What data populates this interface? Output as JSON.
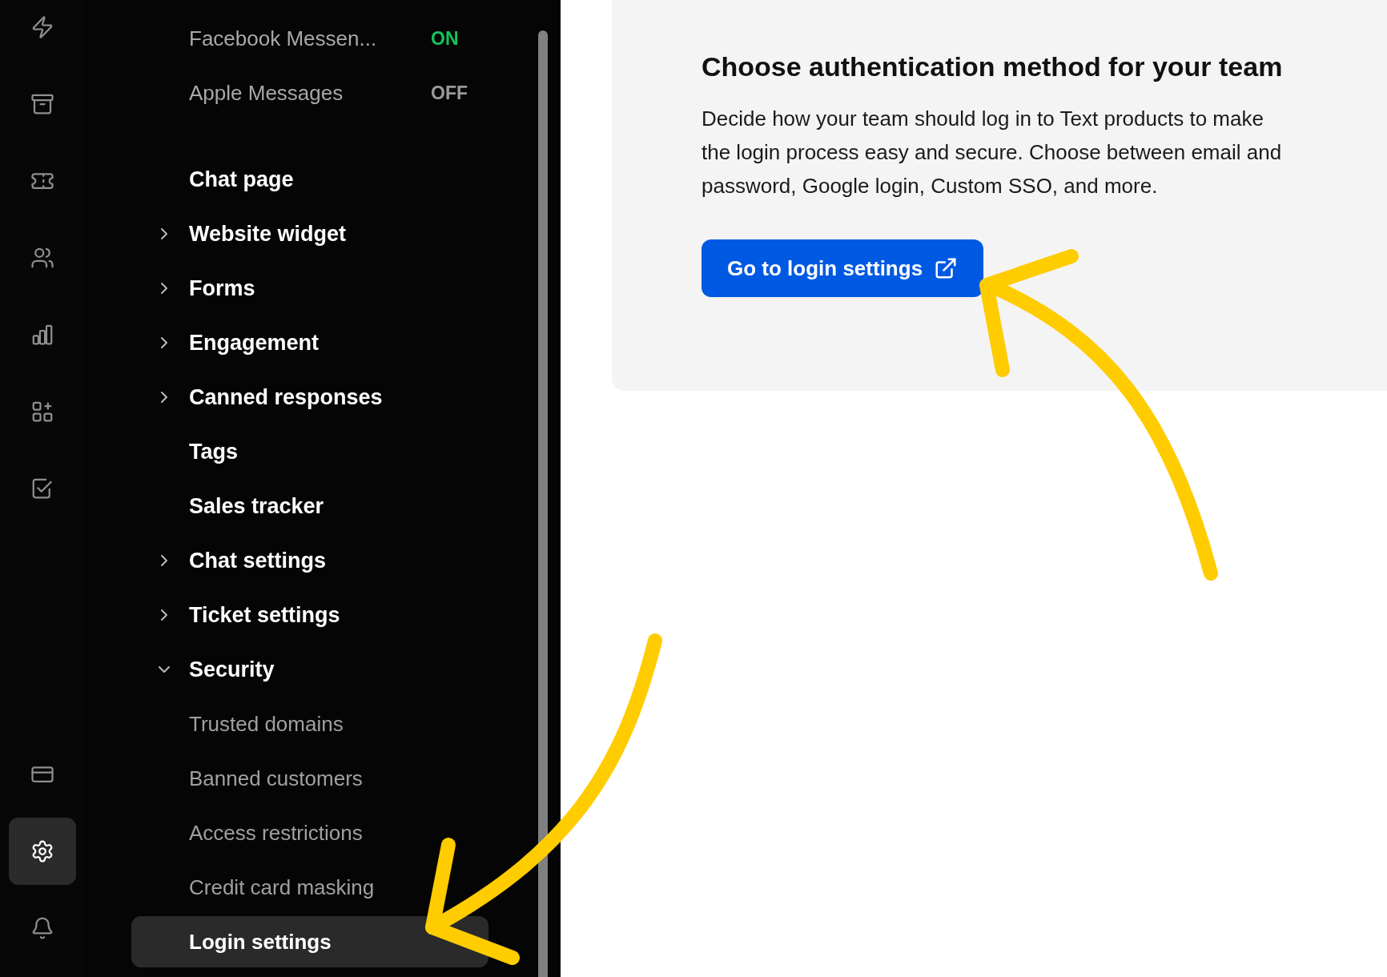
{
  "rail": {
    "top": [
      {
        "selected": false
      },
      {
        "selected": false
      },
      {
        "selected": false
      },
      {
        "selected": false
      },
      {
        "selected": false
      },
      {
        "selected": false
      },
      {
        "selected": false
      }
    ],
    "bottom": [
      {
        "selected": false
      },
      {
        "selected": true
      },
      {
        "selected": false
      }
    ]
  },
  "channels": [
    {
      "name": "Facebook Messen...",
      "status": "ON",
      "on": true
    },
    {
      "name": "Apple Messages",
      "status": "OFF",
      "on": false
    }
  ],
  "nav": [
    {
      "label": "Chat page",
      "kind": "link"
    },
    {
      "label": "Website widget",
      "kind": "group",
      "expanded": false
    },
    {
      "label": "Forms",
      "kind": "group",
      "expanded": false
    },
    {
      "label": "Engagement",
      "kind": "group",
      "expanded": false
    },
    {
      "label": "Canned responses",
      "kind": "group",
      "expanded": false
    },
    {
      "label": "Tags",
      "kind": "link"
    },
    {
      "label": "Sales tracker",
      "kind": "link"
    },
    {
      "label": "Chat settings",
      "kind": "group",
      "expanded": false
    },
    {
      "label": "Ticket settings",
      "kind": "group",
      "expanded": false
    },
    {
      "label": "Security",
      "kind": "group",
      "expanded": true,
      "children": [
        {
          "label": "Trusted domains",
          "selected": false
        },
        {
          "label": "Banned customers",
          "selected": false
        },
        {
          "label": "Access restrictions",
          "selected": false
        },
        {
          "label": "Credit card masking",
          "selected": false
        },
        {
          "label": "Login settings",
          "selected": true
        }
      ]
    }
  ],
  "card": {
    "title": "Choose authentication method for your team",
    "text": "Decide how your team should log in to Text products to make the login process easy and secure. Choose between email and password, Google login, Custom SSO, and more.",
    "button": "Go to login settings"
  }
}
